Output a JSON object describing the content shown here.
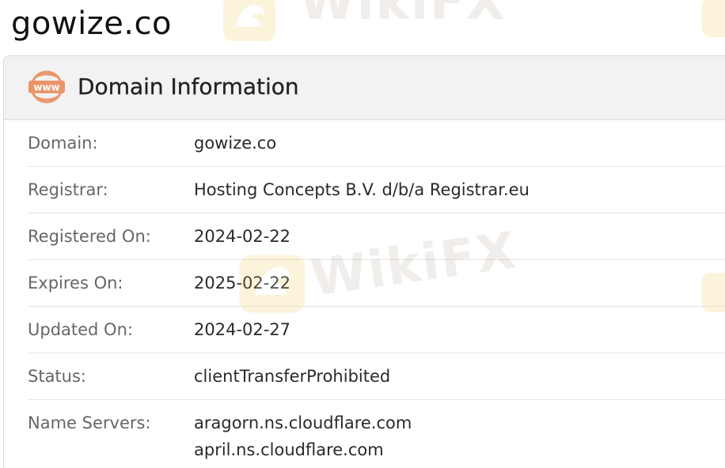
{
  "page_title": "gowize.co",
  "card": {
    "icon": "www-icon",
    "icon_text": "www",
    "title": "Domain Information"
  },
  "rows": [
    {
      "label": "Domain:",
      "value": "gowize.co"
    },
    {
      "label": "Registrar:",
      "value": "Hosting Concepts B.V. d/b/a Registrar.eu"
    },
    {
      "label": "Registered On:",
      "value": "2024-02-22"
    },
    {
      "label": "Expires On:",
      "value": "2025-02-22"
    },
    {
      "label": "Updated On:",
      "value": "2024-02-27"
    },
    {
      "label": "Status:",
      "value": "clientTransferProhibited"
    },
    {
      "label": "Name Servers:",
      "values": [
        "aragorn.ns.cloudflare.com",
        "april.ns.cloudflare.com"
      ]
    }
  ],
  "watermark": {
    "text": "WikiFX",
    "color": "#b0a090",
    "logo_color": "#f0c040"
  },
  "colors": {
    "icon_accent": "#e8956a",
    "header_bg": "#f2f2f2"
  }
}
